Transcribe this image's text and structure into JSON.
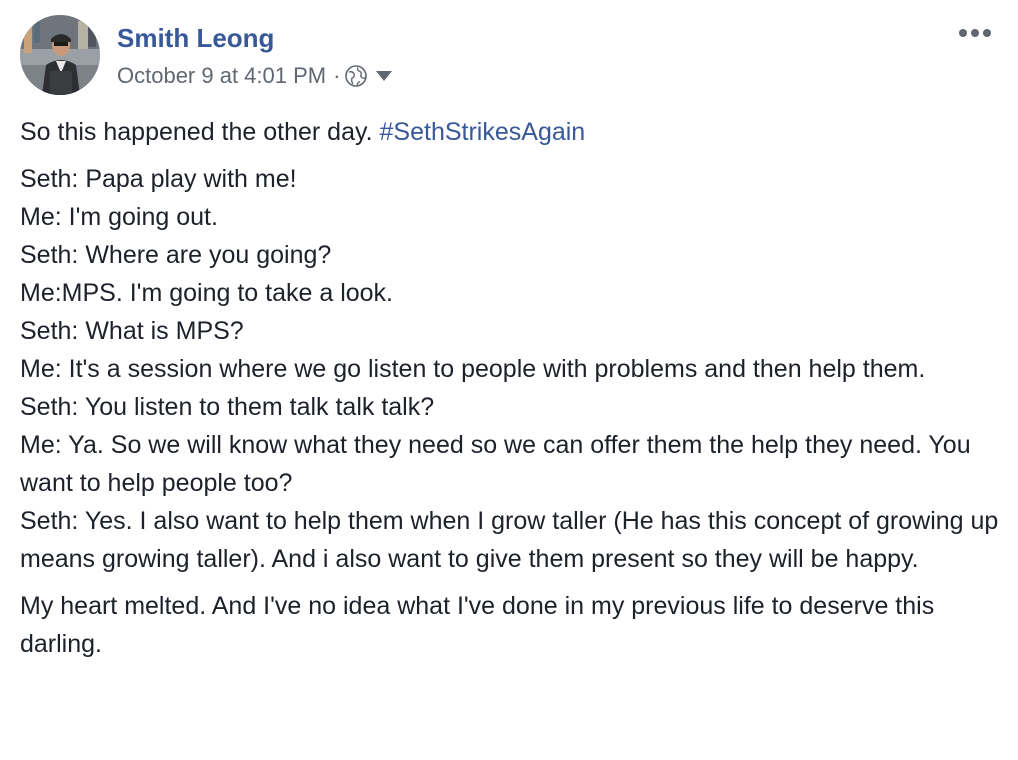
{
  "post": {
    "author": "Smith Leong",
    "timestamp": "October 9 at 4:01 PM",
    "separator": "·",
    "privacy_icon": "globe-icon",
    "menu_icon": "more-options-icon",
    "intro_text": "So this happened the other day. ",
    "hashtag": "#SethStrikesAgain",
    "dialogue": [
      "Seth: Papa play with me!",
      "Me: I'm going out.",
      "Seth: Where are you going?",
      "Me:MPS. I'm going to take a look.",
      "Seth: What is MPS?",
      "Me: It's a session where we go listen to people with problems and then help them.",
      "Seth: You listen to them talk talk talk?",
      "Me: Ya. So we will know what they need so we can offer them the help they need. You want to help people too?",
      "Seth: Yes. I also want to help them when I grow taller (He has this concept of growing up means growing taller). And i also want to give them present so they will be happy."
    ],
    "closing": "My heart melted. And I've no idea what I've done in my previous life to deserve this darling."
  },
  "colors": {
    "link": "#385898",
    "text": "#1d2129",
    "meta": "#616770"
  }
}
